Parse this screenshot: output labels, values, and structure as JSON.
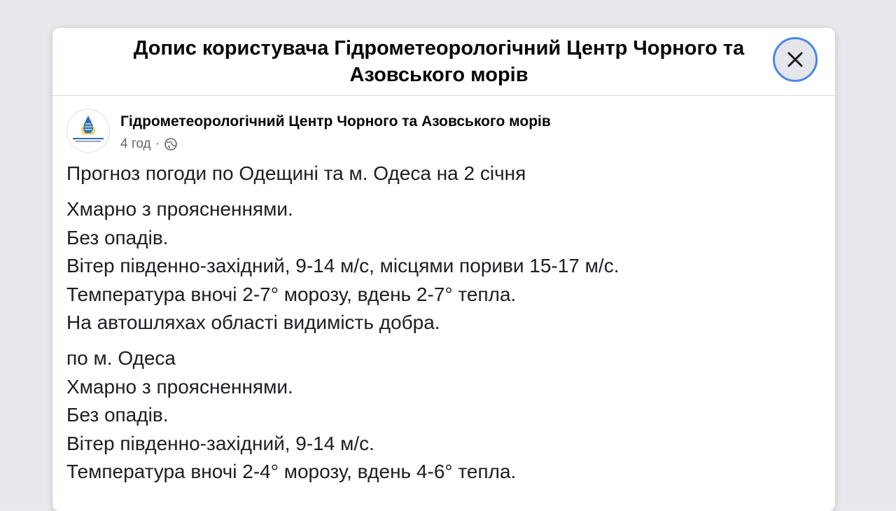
{
  "dialog": {
    "title": "Допис користувача Гідрометеорологічний Центр Чорного та Азовського морів",
    "close_icon": "close-icon"
  },
  "post": {
    "author": "Гідрометеорологічний Центр Чорного та Азовського морів",
    "time": "4 год",
    "separator": "·",
    "privacy_icon": "globe-icon",
    "avatar_icon": "hydromet-logo-icon",
    "paragraphs": [
      [
        "Прогноз погоди по Одещині та м. Одеса на 2 січня"
      ],
      [
        "Хмарно з проясненнями.",
        "Без опадів.",
        "Вітер південно-західний, 9-14 м/с, місцями пориви 15-17 м/с.",
        "Температура вночі 2-7° морозу, вдень 2-7° тепла.",
        "На автошляхах області видимість добра."
      ],
      [
        "по м. Одеса",
        "Хмарно з проясненнями.",
        "Без опадів.",
        "Вітер південно-західний, 9-14 м/с.",
        "Температура вночі 2-4° морозу, вдень 4-6° тепла."
      ]
    ]
  },
  "colors": {
    "backdrop": "#e8e9ed",
    "focus_ring": "#4a86e8",
    "text": "#1c1e21",
    "meta": "#65676b"
  }
}
